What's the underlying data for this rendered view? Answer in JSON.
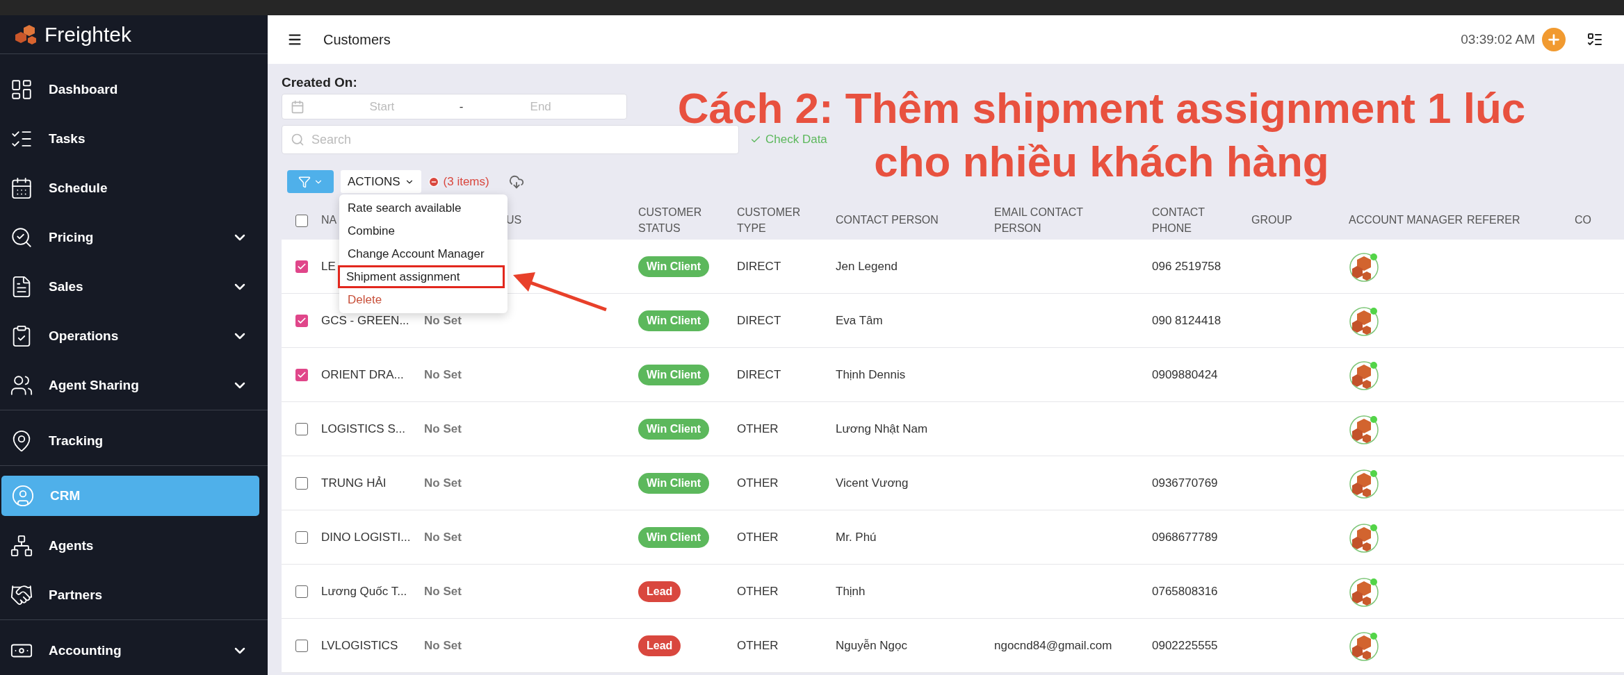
{
  "app": {
    "name": "Freightek"
  },
  "sidebar": {
    "groups": [
      {
        "items": [
          {
            "label": "Dashboard",
            "selected": false
          },
          {
            "label": "Tasks",
            "selected": false
          },
          {
            "label": "Schedule",
            "selected": false
          },
          {
            "label": "Pricing",
            "selected": false,
            "expanded": false
          },
          {
            "label": "Sales",
            "selected": false,
            "expanded": false
          },
          {
            "label": "Operations",
            "selected": false,
            "expanded": false
          },
          {
            "label": "Agent Sharing",
            "selected": false,
            "expanded": false
          }
        ]
      },
      {
        "items": [
          {
            "label": "Tracking",
            "selected": false
          }
        ]
      },
      {
        "items": [
          {
            "label": "CRM",
            "selected": true
          },
          {
            "label": "Agents",
            "selected": false
          },
          {
            "label": "Partners",
            "selected": false
          }
        ]
      },
      {
        "items": [
          {
            "label": "Accounting",
            "selected": false,
            "expanded": false
          }
        ]
      }
    ]
  },
  "header": {
    "title": "Customers",
    "time": "03:39:02 AM"
  },
  "filters": {
    "created_on_label": "Created On:",
    "start_placeholder": "Start",
    "separator": "-",
    "end_placeholder": "End",
    "search_placeholder": "Search",
    "check_data": "Check Data"
  },
  "toolbar": {
    "actions_label": "ACTIONS",
    "selected_count": "(3 items)"
  },
  "actions_menu": [
    {
      "label": "Rate search available",
      "kind": "normal",
      "highlighted": false
    },
    {
      "label": "Combine",
      "kind": "normal",
      "highlighted": false
    },
    {
      "label": "Change Account Manager",
      "kind": "normal",
      "highlighted": false
    },
    {
      "label": "Shipment assignment",
      "kind": "normal",
      "highlighted": true
    },
    {
      "label": "Delete",
      "kind": "danger",
      "highlighted": false
    }
  ],
  "table": {
    "select_all_checked": false,
    "columns": [
      "NA",
      "US",
      "CUSTOMER STATUS",
      "CUSTOMER TYPE",
      "CONTACT PERSON",
      "EMAIL CONTACT PERSON",
      "CONTACT PHONE",
      "GROUP",
      "ACCOUNT MANAGER",
      "REFERER",
      "CO"
    ],
    "rows": [
      {
        "checked": true,
        "name": "LE",
        "assignment": "",
        "status": {
          "label": "Win Client",
          "color": "#5cb85c"
        },
        "type": "DIRECT",
        "contact": "Jen Legend",
        "email": "",
        "phone": "096 2519758"
      },
      {
        "checked": true,
        "name": "GCS - GREEN...",
        "assignment": "No Set",
        "status": {
          "label": "Win Client",
          "color": "#5cb85c"
        },
        "type": "DIRECT",
        "contact": "Eva Tâm",
        "email": "",
        "phone": "090 8124418"
      },
      {
        "checked": true,
        "name": "ORIENT DRA...",
        "assignment": "No Set",
        "status": {
          "label": "Win Client",
          "color": "#5cb85c"
        },
        "type": "DIRECT",
        "contact": "Thịnh Dennis",
        "email": "",
        "phone": "0909880424"
      },
      {
        "checked": false,
        "name": "LOGISTICS S...",
        "assignment": "No Set",
        "status": {
          "label": "Win Client",
          "color": "#5cb85c"
        },
        "type": "OTHER",
        "contact": "Lương Nhật Nam",
        "email": "",
        "phone": ""
      },
      {
        "checked": false,
        "name": "TRUNG HẢI",
        "assignment": "No Set",
        "status": {
          "label": "Win Client",
          "color": "#5cb85c"
        },
        "type": "OTHER",
        "contact": "Vicent Vương",
        "email": "",
        "phone": "0936770769"
      },
      {
        "checked": false,
        "name": "DINO LOGISTI...",
        "assignment": "No Set",
        "status": {
          "label": "Win Client",
          "color": "#5cb85c"
        },
        "type": "OTHER",
        "contact": "Mr. Phú",
        "email": "",
        "phone": "0968677789"
      },
      {
        "checked": false,
        "name": "Lương Quốc T...",
        "assignment": "No Set",
        "status": {
          "label": "Lead",
          "color": "#d9473e"
        },
        "type": "OTHER",
        "contact": "Thịnh",
        "email": "",
        "phone": "0765808316"
      },
      {
        "checked": false,
        "name": "LVLOGISTICS",
        "assignment": "No Set",
        "status": {
          "label": "Lead",
          "color": "#d9473e"
        },
        "type": "OTHER",
        "contact": "Nguyễn Ngọc",
        "email": "ngocnd84@gmail.com",
        "phone": "0902225555"
      }
    ]
  },
  "annotation": {
    "lines": [
      "Cách 2: Thêm shipment assignment 1 lúc",
      "cho nhiều khách hàng"
    ]
  }
}
